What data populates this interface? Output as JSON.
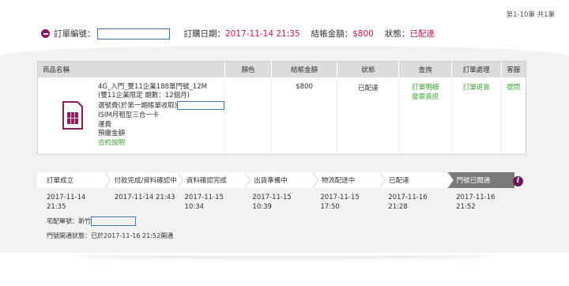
{
  "pager": "第1-10筆 共1筆",
  "order": {
    "number_label": "訂單編號：",
    "number_value": "",
    "date_label": "訂購日期：",
    "date_value": "2017-11-14 21:35",
    "amount_label": "結帳金額：",
    "amount_value": "$800",
    "status_label": "狀態：",
    "status_value": "已配達"
  },
  "table": {
    "headers": [
      "商品名稱",
      "顏色",
      "結帳金額",
      "狀態",
      "查詢",
      "訂單處理",
      "客服"
    ],
    "product_lines": [
      "4G_入門_雙11企業188單門號_12M",
      "(雙11企業限定 期數：12個月)",
      "選號費(於第一期帳單收取)",
      "ISIM月租型三合一卡",
      "運費",
      "預繳金額"
    ],
    "contract_link": "合約說明",
    "color": "",
    "amount": "$800",
    "status": "已配達",
    "query_links": [
      "訂單明細",
      "發票資訊"
    ],
    "process_link": "訂單退貨",
    "service_link": "提問"
  },
  "steps": [
    {
      "label": "訂單成立",
      "date": "2017-11-14",
      "time": "21:35"
    },
    {
      "label": "付款完成/資料確認中",
      "date": "2017-11-14 21:43",
      "time": ""
    },
    {
      "label": "資料確認完成",
      "date": "2017-11-15",
      "time": "10:34"
    },
    {
      "label": "出貨準備中",
      "date": "2017-11-15",
      "time": "10:39"
    },
    {
      "label": "物流配送中",
      "date": "2017-11-15",
      "time": "17:50"
    },
    {
      "label": "已配達",
      "date": "2017-11-16",
      "time": "21:28"
    },
    {
      "label": "門號已開通",
      "date": "2017-11-16",
      "time": "21:52"
    }
  ],
  "shipping": {
    "label": "宅配單號：新竹",
    "value": ""
  },
  "activation": "門號開通狀態：已於2017-11-16 21:52開通",
  "colors": {
    "accent": "#8b1a5e",
    "status_pink": "#c2185b",
    "link_green": "#3aa335"
  }
}
